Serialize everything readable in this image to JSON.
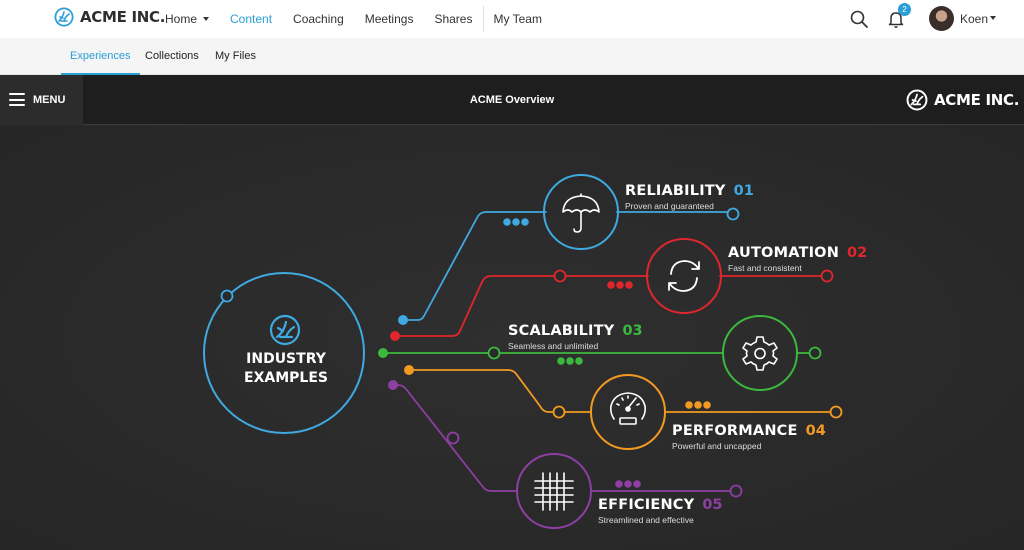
{
  "colors": {
    "accent": "#2a9fd6",
    "reliability": "#3fa9e0",
    "automation": "#e0262d",
    "scalability": "#3db83f",
    "performance": "#f39a21",
    "efficiency": "#8e3fa3",
    "industry_ring": "#3fa9e0"
  },
  "topnav": {
    "brand": "ACME INC.",
    "items": [
      {
        "label": "Home",
        "has_dropdown": true
      },
      {
        "label": "Content",
        "active": true
      },
      {
        "label": "Coaching"
      },
      {
        "label": "Meetings"
      },
      {
        "label": "Shares"
      },
      {
        "label": "My Team"
      }
    ],
    "notifications_count": "2",
    "user_name": "Koen"
  },
  "subnav": {
    "tabs": [
      {
        "label": "Experiences",
        "active": true
      },
      {
        "label": "Collections"
      },
      {
        "label": "My Files"
      }
    ]
  },
  "presentation": {
    "menu_label": "MENU",
    "title": "ACME Overview",
    "brand": "ACME INC."
  },
  "infographic": {
    "center_line1": "INDUSTRY",
    "center_line2": "EXAMPLES",
    "items": [
      {
        "title": "RELIABILITY",
        "number": "01",
        "subtitle": "Proven and guaranteed",
        "icon": "umbrella-icon"
      },
      {
        "title": "AUTOMATION",
        "number": "02",
        "subtitle": "Fast and consistent",
        "icon": "refresh-icon"
      },
      {
        "title": "SCALABILITY",
        "number": "03",
        "subtitle": "Seamless and unlimited",
        "icon": "gear-icon"
      },
      {
        "title": "PERFORMANCE",
        "number": "04",
        "subtitle": "Powerful and uncapped",
        "icon": "speedometer-icon"
      },
      {
        "title": "EFFICIENCY",
        "number": "05",
        "subtitle": "Streamlined and effective",
        "icon": "grid-icon"
      }
    ]
  }
}
